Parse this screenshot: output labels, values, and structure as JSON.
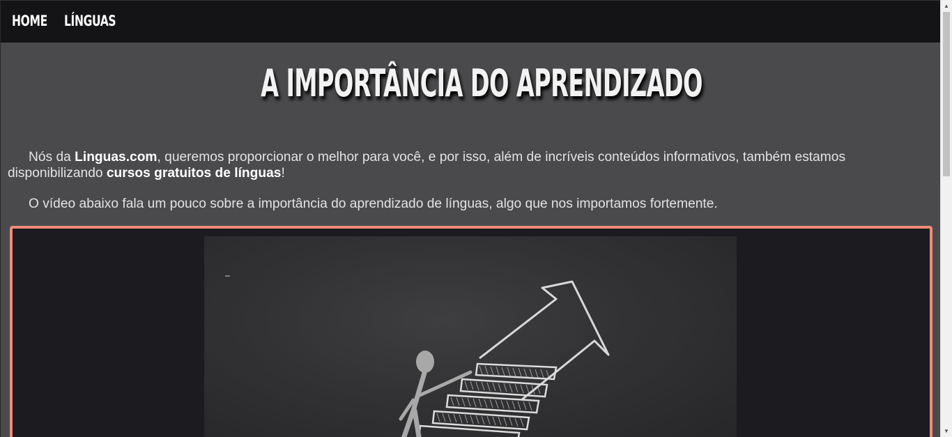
{
  "nav": {
    "home_label": "HOME",
    "linguas_label": "LÍNGUAS"
  },
  "main": {
    "title": "A IMPORTÂNCIA DO APRENDIZADO",
    "para1": {
      "part1": "Nós da ",
      "brand": "Linguas.com",
      "part2": ", queremos proporcionar o melhor para você, e por isso, além de incríveis conteúdos informativos, também estamos disponibilizando ",
      "highlight": "cursos gratuitos de línguas",
      "part3": "!"
    },
    "para2": "O vídeo abaixo fala um pouco sobre a importância do aprendizado de línguas, algo que nos importamos fortemente."
  },
  "colors": {
    "background": "#4a4a4d",
    "nav_background": "#141416",
    "video_border": "#f08a7a"
  },
  "icons": {
    "scroll_up": "triangle-up-icon",
    "scroll_down": "triangle-down-icon"
  }
}
